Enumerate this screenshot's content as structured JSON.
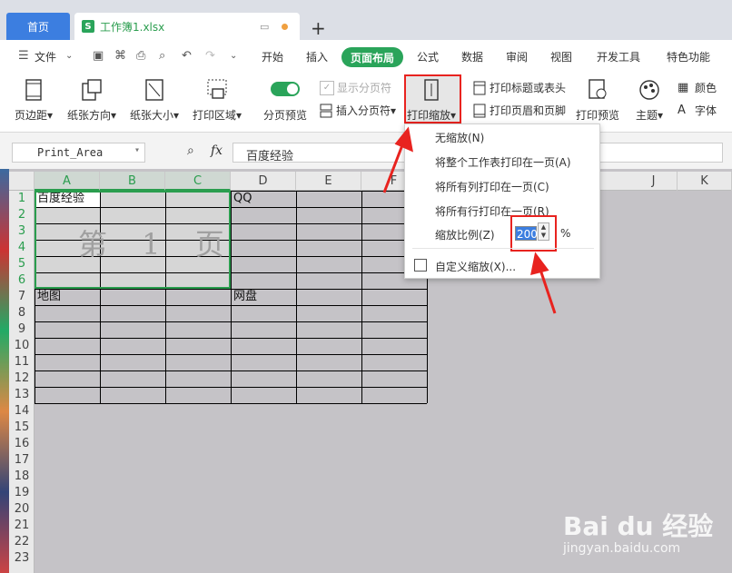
{
  "titlebar": {
    "home_tab": "首页",
    "file_tab": "工作簿1.xlsx",
    "file_badge": "S",
    "add_tab": "+"
  },
  "menubar": {
    "file_menu": "文件",
    "items": [
      "开始",
      "插入",
      "页面布局",
      "公式",
      "数据",
      "审阅",
      "视图",
      "开发工具",
      "特色功能"
    ],
    "active": "页面布局"
  },
  "ribbon": {
    "margins": "页边距",
    "orientation": "纸张方向",
    "size": "纸张大小",
    "print_area": "打印区域",
    "page_break_preview": "分页预览",
    "show_page_breaks": "显示分页符",
    "insert_page_break": "插入分页符",
    "print_scale": "打印缩放",
    "print_titles": "打印标题或表头",
    "header_footer": "打印页眉和页脚",
    "print_preview": "打印预览",
    "theme": "主题",
    "colors": "颜色",
    "fonts": "字体",
    "dropdown_indicator": "▾"
  },
  "formula_bar": {
    "name_box": "Print_Area",
    "fx": "fx",
    "value": "百度经验"
  },
  "grid": {
    "columns": [
      "A",
      "B",
      "C",
      "D",
      "E",
      "F",
      "J",
      "K"
    ],
    "rows": [
      "1",
      "2",
      "3",
      "4",
      "5",
      "6",
      "7",
      "8",
      "9",
      "10",
      "11",
      "12",
      "13",
      "14",
      "15",
      "16",
      "17",
      "18",
      "19",
      "20",
      "21",
      "22",
      "23"
    ],
    "cells": {
      "A1": "百度经验",
      "D1": "QQ",
      "A7": "地图",
      "D7": "网盘"
    },
    "page_watermark": "第 1 页"
  },
  "dropdown": {
    "items": [
      "无缩放(N)",
      "将整个工作表打印在一页(A)",
      "将所有列打印在一页(C)",
      "将所有行打印在一页(R)"
    ],
    "scale_label": "缩放比例(Z)",
    "scale_value": "200",
    "scale_unit": "%",
    "custom": "自定义缩放(X)..."
  },
  "watermark": {
    "logo": "Bai du 经验",
    "url": "jingyan.baidu.com"
  },
  "colors": {
    "accent_green": "#2aa45a",
    "tab_blue": "#3c7ee0",
    "highlight_red": "#e8231f"
  }
}
